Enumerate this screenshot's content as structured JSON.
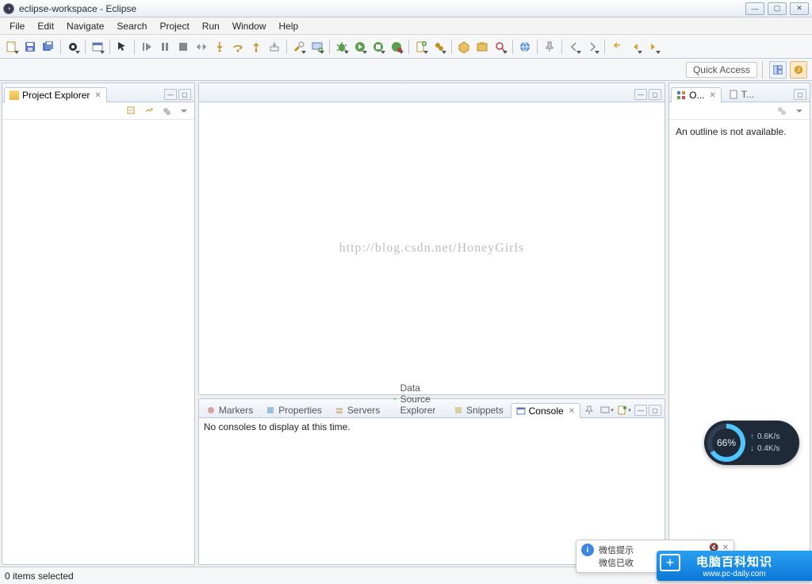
{
  "window": {
    "title": "eclipse-workspace - Eclipse"
  },
  "menus": [
    "File",
    "Edit",
    "Navigate",
    "Search",
    "Project",
    "Run",
    "Window",
    "Help"
  ],
  "quick_access": "Quick Access",
  "project_explorer": {
    "title": "Project Explorer"
  },
  "editor": {
    "watermark": "http://blog.csdn.net/HoneyGirls"
  },
  "outline": {
    "tab_o": "O...",
    "tab_t": "T...",
    "message": "An outline is not available."
  },
  "bottom_tabs": {
    "markers": "Markers",
    "properties": "Properties",
    "servers": "Servers",
    "dse": "Data Source Explorer",
    "snippets": "Snippets",
    "console": "Console"
  },
  "console": {
    "empty": "No consoles to display at this time."
  },
  "statusbar": {
    "left": "0 items selected"
  },
  "net_widget": {
    "percent": "66%",
    "up": "0.6K/s",
    "down": "0.4K/s"
  },
  "notification": {
    "title": "微信提示",
    "body": "微信已收"
  },
  "brand": {
    "line1": "电脑百科知识",
    "line2": "www.pc-daily.com",
    "icon": "+"
  }
}
